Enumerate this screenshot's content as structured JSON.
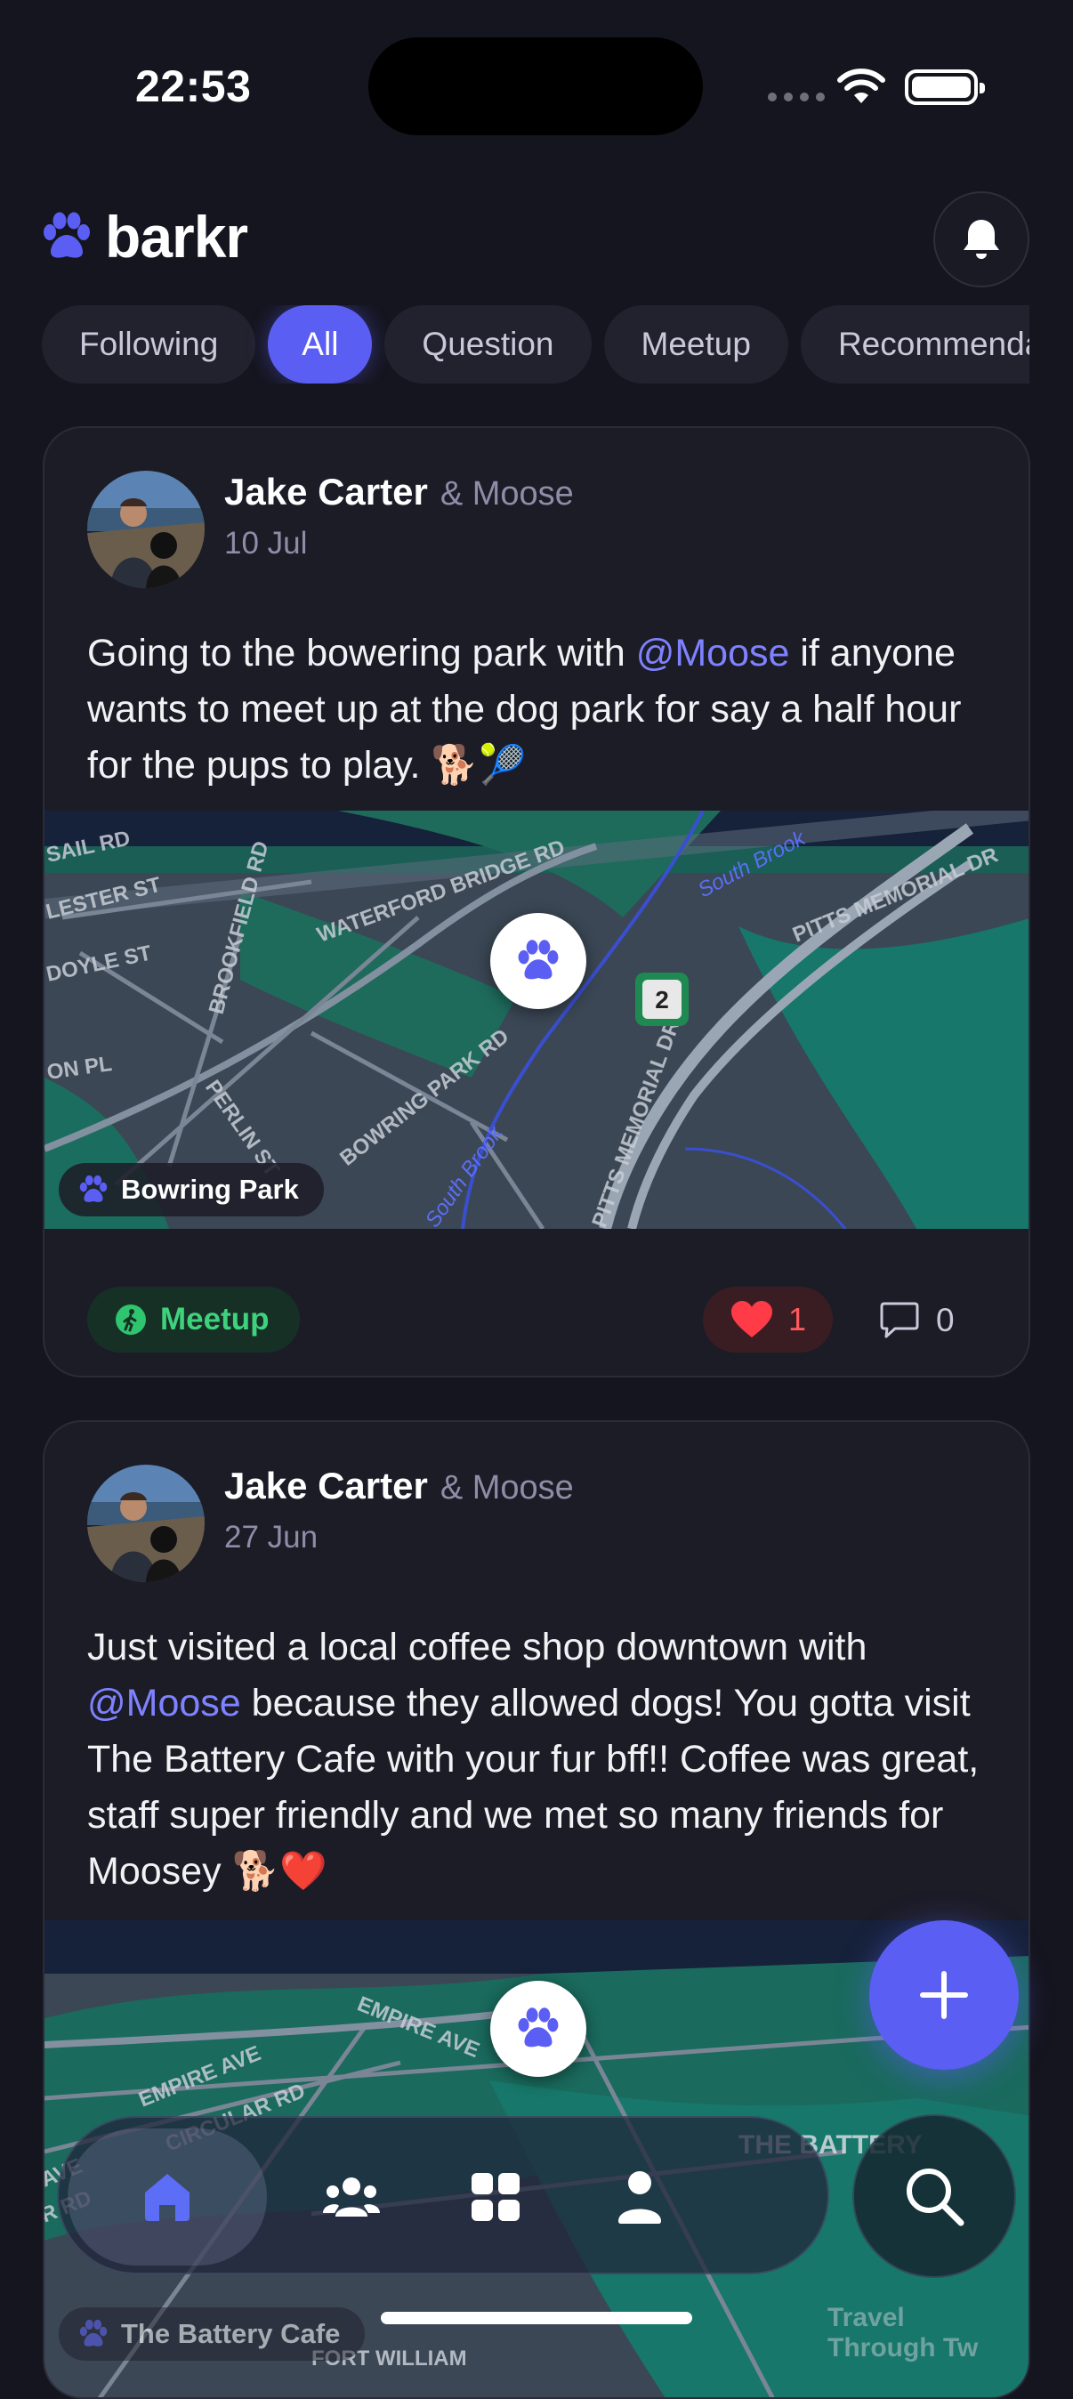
{
  "status_bar": {
    "time": "22:53"
  },
  "header": {
    "logo_text": "barkr"
  },
  "tabs": [
    {
      "label": "Following",
      "active": false
    },
    {
      "label": "All",
      "active": true
    },
    {
      "label": "Question",
      "active": false
    },
    {
      "label": "Meetup",
      "active": false
    },
    {
      "label": "Recommendation",
      "active": false
    }
  ],
  "posts": [
    {
      "author": "Jake Carter",
      "pet": "& Moose",
      "date": "10 Jul",
      "text_before": "Going to the bowering park with ",
      "mention": "@Moose",
      "text_after": " if anyone wants to meet up at the dog park for say a half hour for the pups to play. 🐕🎾",
      "map": {
        "place": "Bowring Park",
        "labels": [
          "SAIL RD",
          "LESTER ST",
          "DOYLE ST",
          "ON PL",
          "BROOKFIELD RD",
          "WATERFORD BRIDGE RD",
          "BOWRING PARK RD",
          "PERLIN ST",
          "PITTS MEMORIAL DR",
          "South Brook",
          "2"
        ]
      },
      "tag": "Meetup",
      "likes": "1",
      "comments": "0"
    },
    {
      "author": "Jake Carter",
      "pet": "& Moose",
      "date": "27 Jun",
      "text_before": "Just visited a local coffee shop downtown with ",
      "mention": "@Moose",
      "text_after": " because they allowed dogs! You gotta visit The Battery Cafe with your fur bff!! Coffee was great, staff super friendly and we met so many friends for Moosey 🐕❤️",
      "map": {
        "place": "The Battery Cafe",
        "labels": [
          "EMPIRE AVE",
          "CIRCULAR RD",
          "THE BATTERY",
          "FORT WILLIAM",
          "Travel Through Tw"
        ]
      }
    }
  ],
  "colors": {
    "accent": "#5b5ef3",
    "meetup": "#3fd27d",
    "like": "#ff5a5f",
    "mention": "#7e82ff"
  }
}
